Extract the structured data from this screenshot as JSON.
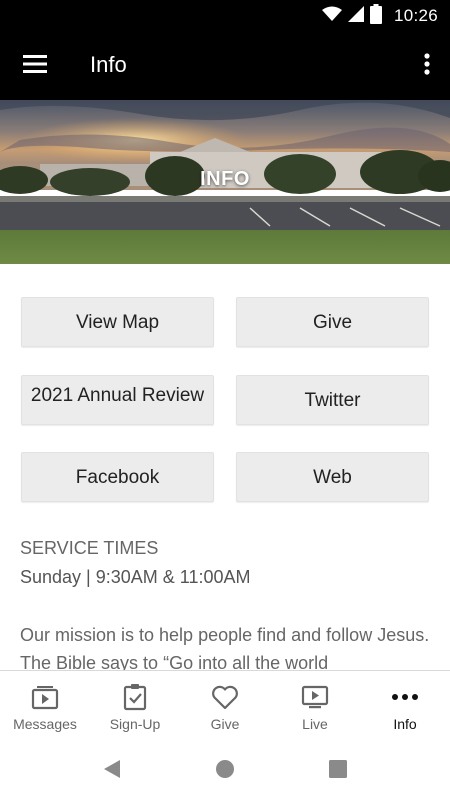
{
  "status_bar": {
    "time": "10:26"
  },
  "app_bar": {
    "title": "Info"
  },
  "hero": {
    "label": "INFO"
  },
  "buttons": [
    {
      "label": "View Map"
    },
    {
      "label": "Give"
    },
    {
      "label": "2021 Annual Review"
    },
    {
      "label": "Twitter"
    },
    {
      "label": "Facebook"
    },
    {
      "label": "Web"
    }
  ],
  "content": {
    "service_heading": "SERVICE TIMES",
    "service_times": "Sunday | 9:30AM & 11:00AM",
    "mission": "Our mission is to help people find and follow Jesus. The Bible says to “Go into all the world"
  },
  "bottom_nav": [
    {
      "label": "Messages",
      "icon": "messages-icon"
    },
    {
      "label": "Sign-Up",
      "icon": "signup-clipboard-icon"
    },
    {
      "label": "Give",
      "icon": "heart-icon"
    },
    {
      "label": "Live",
      "icon": "live-tv-icon"
    },
    {
      "label": "Info",
      "icon": "more-dots-icon",
      "active": true
    }
  ],
  "colors": {
    "bar": "#000000",
    "button_bg": "#ececec",
    "text_gray": "#666666"
  }
}
